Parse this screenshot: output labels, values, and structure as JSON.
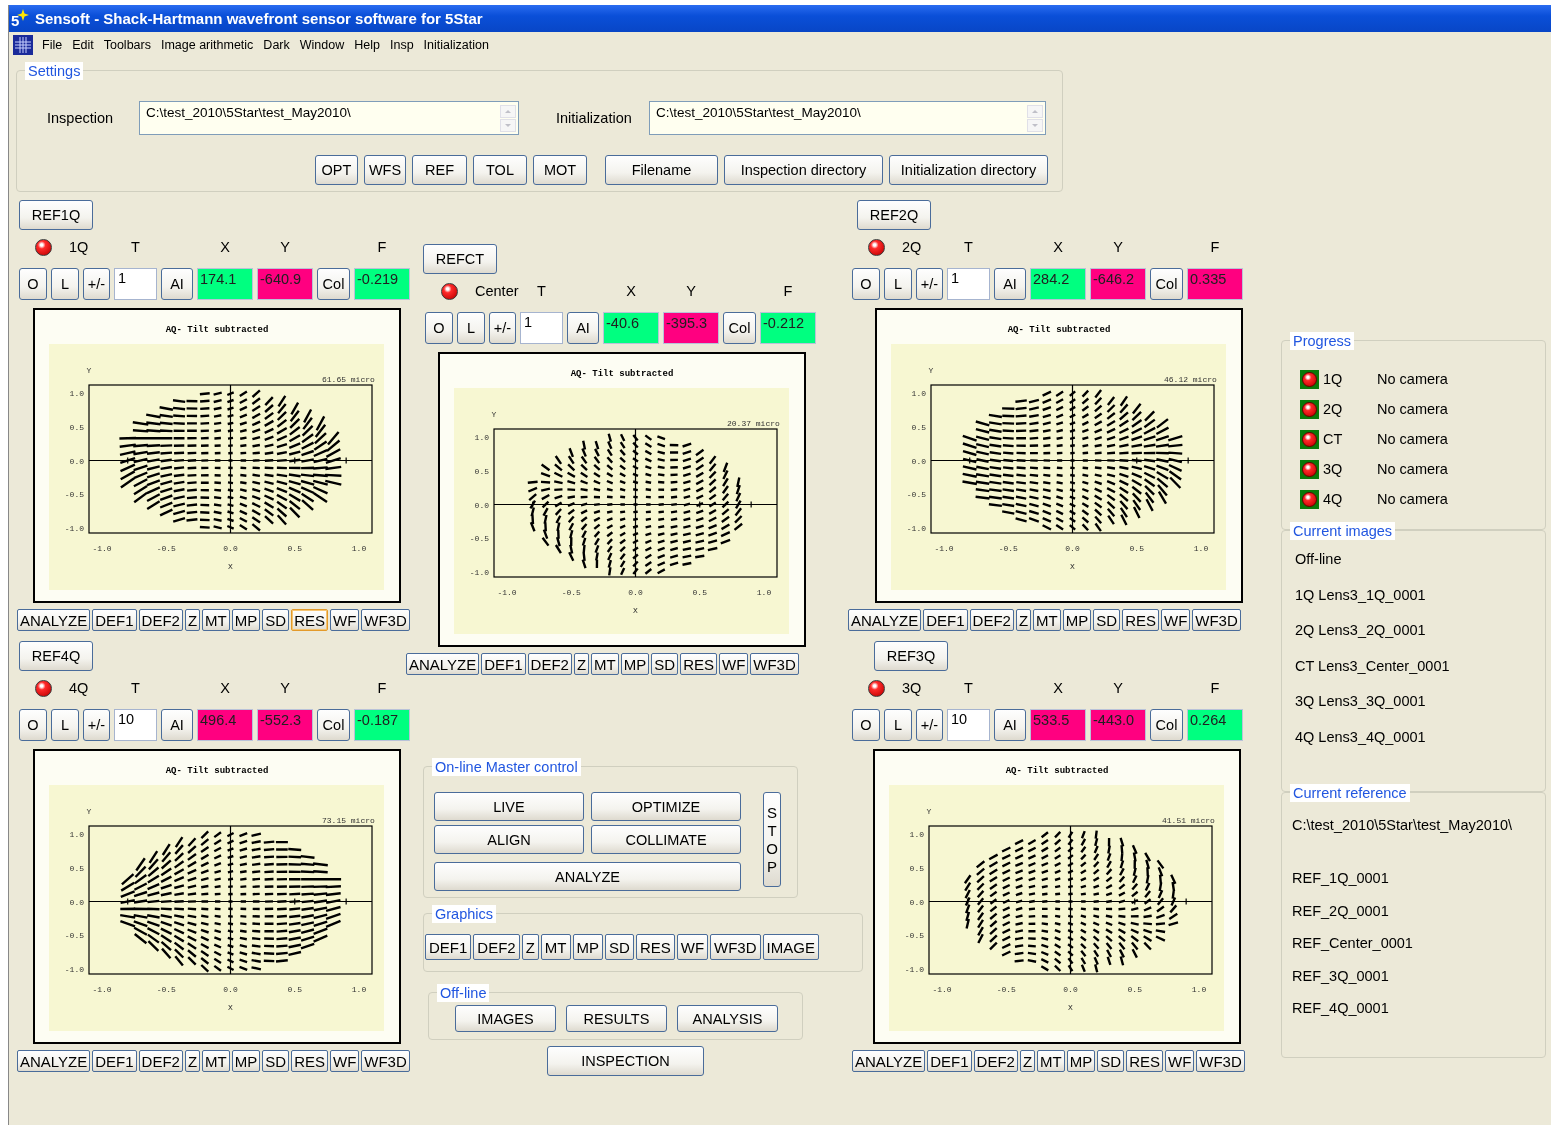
{
  "window": {
    "icon_text": "5",
    "title": "Sensoft - Shack-Hartmann wavefront sensor software for 5Star"
  },
  "menu": [
    "File",
    "Edit",
    "Toolbars",
    "Image arithmetic",
    "Dark",
    "Window",
    "Help",
    "Insp",
    "Initialization"
  ],
  "settings": {
    "title": "Settings",
    "fields": [
      {
        "label": "Inspection",
        "value": "C:\\test_2010\\5Star\\test_May2010\\"
      },
      {
        "label": "Initialization",
        "value": "C:\\test_2010\\5Star\\test_May2010\\"
      }
    ],
    "buttons": [
      "OPT",
      "WFS",
      "REF",
      "TOL",
      "MOT",
      "Filename",
      "Inspection directory",
      "Initialization directory"
    ]
  },
  "quadrants": [
    {
      "ref_button": "REF1Q",
      "active": false,
      "name": "1Q",
      "headers": [
        "T",
        "X",
        "Y",
        "F"
      ],
      "buttons": [
        "O",
        "L",
        "+/-"
      ],
      "t_value": "1",
      "ai_button": "AI",
      "x": {
        "text": "174.1",
        "color": "#00ff80"
      },
      "y": {
        "text": "-640.9",
        "color": "#ff0080"
      },
      "col_button": "Col",
      "f": {
        "text": "-0.219",
        "color": "#00ff80"
      },
      "plot": {
        "title": "AQ- Tilt subtracted",
        "xlabel": "X",
        "ylabel": "Y",
        "xticks": [
          "-1.0",
          "-0.5",
          "0.0",
          "0.5",
          "1.0"
        ],
        "yticks": [
          "1.0",
          "0.5",
          "0.0",
          "-0.5",
          "-1.0"
        ],
        "scale_label": "61.65 micro"
      },
      "graphics": [
        {
          "label": "ANALYZE",
          "selected": false
        },
        {
          "label": "DEF1",
          "selected": false
        },
        {
          "label": "DEF2",
          "selected": false
        },
        {
          "label": "Z",
          "selected": false
        },
        {
          "label": "MT",
          "selected": false
        },
        {
          "label": "MP",
          "selected": false
        },
        {
          "label": "SD",
          "selected": false
        },
        {
          "label": "RES",
          "selected": true
        },
        {
          "label": "WF",
          "selected": false
        },
        {
          "label": "WF3D",
          "selected": false
        }
      ]
    },
    {
      "ref_button": "REFCT",
      "active": false,
      "name": "Center",
      "headers": [
        "T",
        "X",
        "Y",
        "F"
      ],
      "buttons": [
        "O",
        "L",
        "+/-"
      ],
      "t_value": "1",
      "ai_button": "AI",
      "x": {
        "text": "-40.6",
        "color": "#00ff80"
      },
      "y": {
        "text": "-395.3",
        "color": "#ff0080"
      },
      "col_button": "Col",
      "f": {
        "text": "-0.212",
        "color": "#00ff80"
      },
      "plot": {
        "title": "AQ- Tilt subtracted",
        "xlabel": "X",
        "ylabel": "Y",
        "xticks": [
          "-1.0",
          "-0.5",
          "0.0",
          "0.5",
          "1.0"
        ],
        "yticks": [
          "1.0",
          "0.5",
          "0.0",
          "-0.5",
          "-1.0"
        ],
        "scale_label": "20.37 micro"
      },
      "graphics": [
        {
          "label": "ANALYZE",
          "selected": false
        },
        {
          "label": "DEF1",
          "selected": false
        },
        {
          "label": "DEF2",
          "selected": false
        },
        {
          "label": "Z",
          "selected": false
        },
        {
          "label": "MT",
          "selected": false
        },
        {
          "label": "MP",
          "selected": false
        },
        {
          "label": "SD",
          "selected": false
        },
        {
          "label": "RES",
          "selected": false
        },
        {
          "label": "WF",
          "selected": false
        },
        {
          "label": "WF3D",
          "selected": false
        }
      ]
    },
    {
      "ref_button": "REF2Q",
      "active": false,
      "name": "2Q",
      "headers": [
        "T",
        "X",
        "Y",
        "F"
      ],
      "buttons": [
        "O",
        "L",
        "+/-"
      ],
      "t_value": "1",
      "ai_button": "AI",
      "x": {
        "text": "284.2",
        "color": "#00ff80"
      },
      "y": {
        "text": "-646.2",
        "color": "#ff0080"
      },
      "col_button": "Col",
      "f": {
        "text": "0.335",
        "color": "#ff0080"
      },
      "plot": {
        "title": "AQ- Tilt subtracted",
        "xlabel": "X",
        "ylabel": "Y",
        "xticks": [
          "-1.0",
          "-0.5",
          "0.0",
          "0.5",
          "1.0"
        ],
        "yticks": [
          "1.0",
          "0.5",
          "0.0",
          "-0.5",
          "-1.0"
        ],
        "scale_label": "46.12 micro"
      },
      "graphics": [
        {
          "label": "ANALYZE",
          "selected": false
        },
        {
          "label": "DEF1",
          "selected": false
        },
        {
          "label": "DEF2",
          "selected": false
        },
        {
          "label": "Z",
          "selected": false
        },
        {
          "label": "MT",
          "selected": false
        },
        {
          "label": "MP",
          "selected": false
        },
        {
          "label": "SD",
          "selected": false
        },
        {
          "label": "RES",
          "selected": false
        },
        {
          "label": "WF",
          "selected": false
        },
        {
          "label": "WF3D",
          "selected": false
        }
      ]
    },
    {
      "ref_button": "REF4Q",
      "active": false,
      "name": "4Q",
      "headers": [
        "T",
        "X",
        "Y",
        "F"
      ],
      "buttons": [
        "O",
        "L",
        "+/-"
      ],
      "t_value": "10",
      "ai_button": "AI",
      "x": {
        "text": "496.4",
        "color": "#ff0080"
      },
      "y": {
        "text": "-552.3",
        "color": "#ff0080"
      },
      "col_button": "Col",
      "f": {
        "text": "-0.187",
        "color": "#00ff80"
      },
      "plot": {
        "title": "AQ- Tilt subtracted",
        "xlabel": "X",
        "ylabel": "Y",
        "xticks": [
          "-1.0",
          "-0.5",
          "0.0",
          "0.5",
          "1.0"
        ],
        "yticks": [
          "1.0",
          "0.5",
          "0.0",
          "-0.5",
          "-1.0"
        ],
        "scale_label": "73.15 micro"
      },
      "graphics": [
        {
          "label": "ANALYZE",
          "selected": false
        },
        {
          "label": "DEF1",
          "selected": false
        },
        {
          "label": "DEF2",
          "selected": false
        },
        {
          "label": "Z",
          "selected": false
        },
        {
          "label": "MT",
          "selected": false
        },
        {
          "label": "MP",
          "selected": false
        },
        {
          "label": "SD",
          "selected": false
        },
        {
          "label": "RES",
          "selected": false
        },
        {
          "label": "WF",
          "selected": false
        },
        {
          "label": "WF3D",
          "selected": false
        }
      ]
    },
    {
      "ref_button": "REF3Q",
      "active": false,
      "name": "3Q",
      "headers": [
        "T",
        "X",
        "Y",
        "F"
      ],
      "buttons": [
        "O",
        "L",
        "+/-"
      ],
      "t_value": "10",
      "ai_button": "AI",
      "x": {
        "text": "533.5",
        "color": "#ff0080"
      },
      "y": {
        "text": "-443.0",
        "color": "#ff0080"
      },
      "col_button": "Col",
      "f": {
        "text": "0.264",
        "color": "#00ff80"
      },
      "plot": {
        "title": "AQ- Tilt subtracted",
        "xlabel": "X",
        "ylabel": "Y",
        "xticks": [
          "-1.0",
          "-0.5",
          "0.0",
          "0.5",
          "1.0"
        ],
        "yticks": [
          "1.0",
          "0.5",
          "0.0",
          "-0.5",
          "-1.0"
        ],
        "scale_label": "41.51 micro"
      },
      "graphics": [
        {
          "label": "ANALYZE",
          "selected": false
        },
        {
          "label": "DEF1",
          "selected": false
        },
        {
          "label": "DEF2",
          "selected": false
        },
        {
          "label": "Z",
          "selected": false
        },
        {
          "label": "MT",
          "selected": false
        },
        {
          "label": "MP",
          "selected": false
        },
        {
          "label": "SD",
          "selected": false
        },
        {
          "label": "RES",
          "selected": false
        },
        {
          "label": "WF",
          "selected": false
        },
        {
          "label": "WF3D",
          "selected": false
        }
      ]
    }
  ],
  "master": {
    "online": {
      "title": "On-line Master control",
      "buttons": [
        "LIVE",
        "OPTIMIZE",
        "ALIGN",
        "COLLIMATE",
        "ANALYZE"
      ],
      "stop": "STOP"
    },
    "graphics": {
      "title": "Graphics",
      "buttons": [
        "DEF1",
        "DEF2",
        "Z",
        "MT",
        "MP",
        "SD",
        "RES",
        "WF",
        "WF3D",
        "IMAGE"
      ]
    },
    "offline": {
      "title": "Off-line",
      "buttons": [
        "IMAGES",
        "RESULTS",
        "ANALYSIS"
      ]
    },
    "inspection_button": "INSPECTION"
  },
  "side": {
    "progress": {
      "title": "Progress",
      "items": [
        {
          "label": "1Q",
          "status": "No camera",
          "active": false
        },
        {
          "label": "2Q",
          "status": "No camera",
          "active": false
        },
        {
          "label": "CT",
          "status": "No camera",
          "active": false
        },
        {
          "label": "3Q",
          "status": "No camera",
          "active": false
        },
        {
          "label": "4Q",
          "status": "No camera",
          "active": false
        }
      ]
    },
    "current_images": {
      "title": "Current images",
      "lines": [
        "Off-line",
        "1Q Lens3_1Q_0001",
        "2Q Lens3_2Q_0001",
        "CT Lens3_Center_0001",
        "3Q Lens3_3Q_0001",
        "4Q Lens3_4Q_0001"
      ]
    },
    "current_reference": {
      "title": "Current reference",
      "path": "C:\\test_2010\\5Star\\test_May2010\\",
      "items": [
        "REF_1Q_0001",
        "REF_2Q_0001",
        "REF_Center_0001",
        "REF_3Q_0001",
        "REF_4Q_0001"
      ]
    }
  }
}
